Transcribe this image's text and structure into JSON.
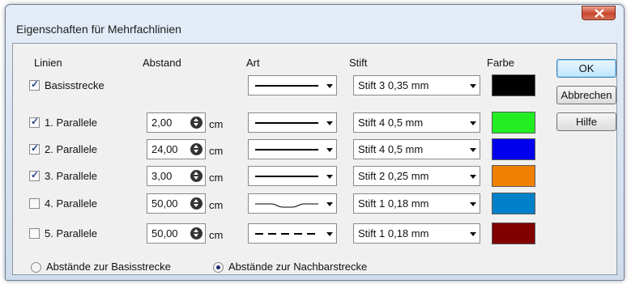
{
  "window": {
    "title": "Eigenschaften für Mehrfachlinien"
  },
  "headers": {
    "linien": "Linien",
    "abstand": "Abstand",
    "art": "Art",
    "stift": "Stift",
    "farbe": "Farbe"
  },
  "buttons": {
    "ok": "OK",
    "cancel": "Abbrechen",
    "help": "Hilfe"
  },
  "rows": [
    {
      "label": "Basisstrecke",
      "checked": true,
      "spacing": "",
      "unit": "",
      "line_style": "solid",
      "pen": "Stift 3  0,35 mm",
      "color": "#000000"
    },
    {
      "label": "1. Parallele",
      "checked": true,
      "spacing": "2,00",
      "unit": "cm",
      "line_style": "solid",
      "pen": "Stift 4  0,5 mm",
      "color": "#22ee22"
    },
    {
      "label": "2. Parallele",
      "checked": true,
      "spacing": "24,00",
      "unit": "cm",
      "line_style": "solid",
      "pen": "Stift 4  0,5 mm",
      "color": "#0000ee"
    },
    {
      "label": "3. Parallele",
      "checked": true,
      "spacing": "3,00",
      "unit": "cm",
      "line_style": "solid",
      "pen": "Stift 2  0,25 mm",
      "color": "#f08000"
    },
    {
      "label": "4. Parallele",
      "checked": false,
      "spacing": "50,00",
      "unit": "cm",
      "line_style": "wave",
      "pen": "Stift 1  0,18 mm",
      "color": "#0080c8"
    },
    {
      "label": "5. Parallele",
      "checked": false,
      "spacing": "50,00",
      "unit": "cm",
      "line_style": "dashed",
      "pen": "Stift 1  0,18 mm",
      "color": "#800000"
    }
  ],
  "radios": [
    {
      "label": "Abstände zur Basisstrecke",
      "selected": false
    },
    {
      "label": "Abstände zur Nachbarstrecke",
      "selected": true
    }
  ]
}
